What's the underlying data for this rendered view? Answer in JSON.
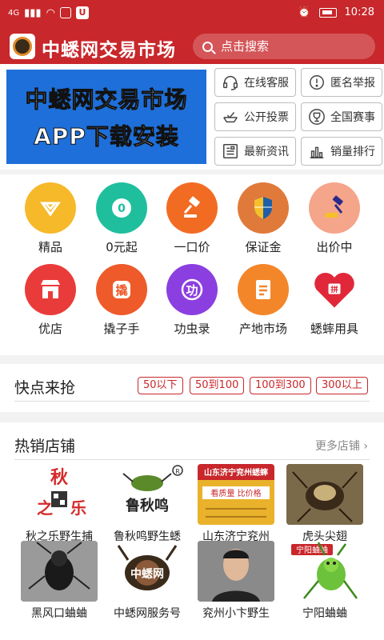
{
  "status_bar": {
    "time": "10:28",
    "network": "4G"
  },
  "header": {
    "title": "中蟋网交易市场",
    "search_placeholder": "点击搜索"
  },
  "banner": {
    "line1": "中蟋网交易市场",
    "line2": "APP下载安装"
  },
  "quick_buttons": [
    {
      "label": "在线客服",
      "icon": "headset-icon"
    },
    {
      "label": "匿名举报",
      "icon": "exclamation-icon"
    },
    {
      "label": "公开投票",
      "icon": "vote-icon"
    },
    {
      "label": "全国赛事",
      "icon": "trophy-icon"
    },
    {
      "label": "最新资讯",
      "icon": "news-icon"
    },
    {
      "label": "销量排行",
      "icon": "bar-chart-icon"
    }
  ],
  "categories": [
    {
      "label": "精品",
      "icon": "diamond-icon",
      "color": "#f5b92a",
      "glyph": ""
    },
    {
      "label": "0元起",
      "icon": "zero-badge-icon",
      "color": "#1fbf9e",
      "glyph": "0"
    },
    {
      "label": "一口价",
      "icon": "gavel-icon",
      "color": "#f26b22",
      "glyph": ""
    },
    {
      "label": "保证金",
      "icon": "shield-icon",
      "color": "#e07a3a",
      "glyph": ""
    },
    {
      "label": "出价中",
      "icon": "auction-hammer-icon",
      "color": "#f5a58a",
      "glyph": ""
    },
    {
      "label": "优店",
      "icon": "shop-icon",
      "color": "#ea3b3b",
      "glyph": ""
    },
    {
      "label": "撬子手",
      "icon": "qiao-icon",
      "color": "#ee5a2a",
      "glyph": "撬"
    },
    {
      "label": "功虫录",
      "icon": "gong-icon",
      "color": "#8b3fe0",
      "glyph": "功"
    },
    {
      "label": "产地市场",
      "icon": "market-doc-icon",
      "color": "#f4862a",
      "glyph": ""
    },
    {
      "label": "蟋蟀用具",
      "icon": "pin-shop-icon",
      "color": "#e0283a",
      "glyph": "拼"
    }
  ],
  "price_section": {
    "title": "快点来抢",
    "tags": [
      "50以下",
      "50到100",
      "100到300",
      "300以上"
    ]
  },
  "hot_shops": {
    "title": "热销店铺",
    "more": "更多店铺",
    "shops": [
      {
        "name": "秋之乐野生捕",
        "logo_text": "秋之乐",
        "bg": "#ffffff",
        "fg": "#d42a2a"
      },
      {
        "name": "鲁秋鸣野生蟋",
        "logo_text": "鲁秋鸣",
        "bg": "#ffffff",
        "fg": "#222222"
      },
      {
        "name": "山东济宁兖州",
        "logo_text": "山东济宁兖州蟋蟀",
        "bg": "#e9b22a",
        "fg": "#c8272b"
      },
      {
        "name": "虎头尖翅",
        "logo_text": "",
        "bg": "#6b5a3a",
        "fg": "#ffffff"
      },
      {
        "name": "黑风口蛐蛐",
        "logo_text": "",
        "bg": "#8a8a8a",
        "fg": "#ffffff"
      },
      {
        "name": "中蟋网服务号",
        "logo_text": "中蟋网",
        "bg": "#ffffff",
        "fg": "#222222"
      },
      {
        "name": "兖州小卞野生",
        "logo_text": "",
        "bg": "#555555",
        "fg": "#ffffff"
      },
      {
        "name": "宁阳蛐蛐",
        "logo_text": "宁阳蛐蛐",
        "bg": "#ffffff",
        "fg": "#c8272b"
      }
    ]
  }
}
